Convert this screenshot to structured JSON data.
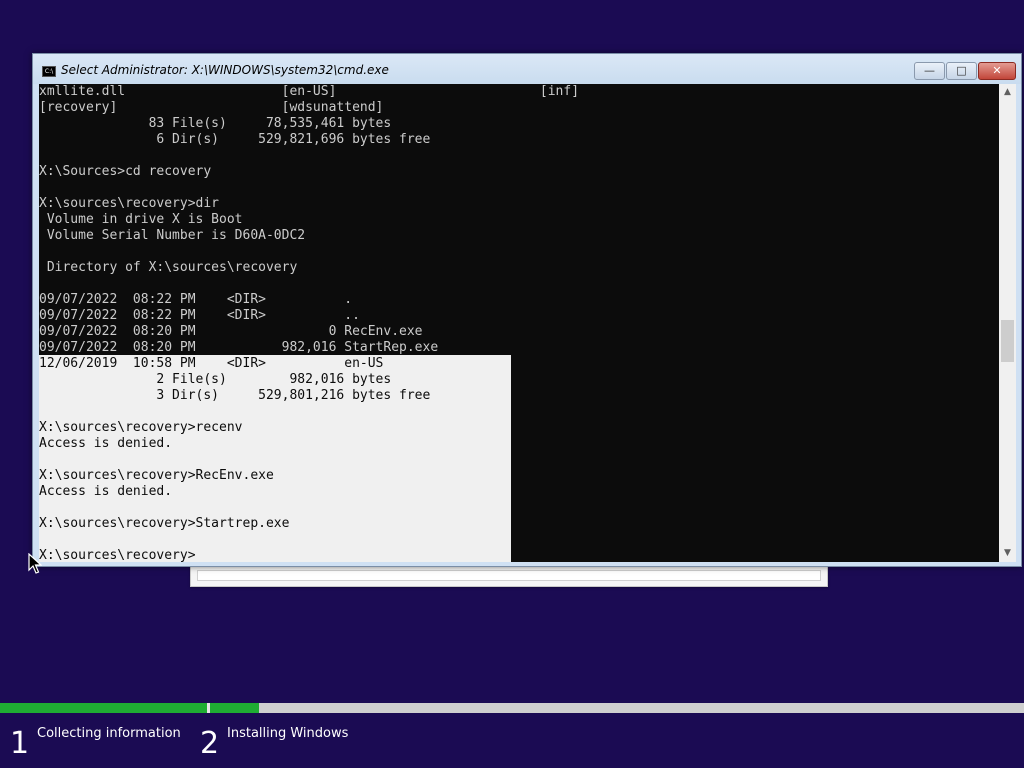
{
  "window": {
    "title": "Select Administrator: X:\\WINDOWS\\system32\\cmd.exe",
    "icon": "cmd-icon",
    "icon_text": "C:\\",
    "minimize_icon": "minimize-icon",
    "maximize_icon": "maximize-icon",
    "close_icon": "close-icon"
  },
  "console": {
    "lines": [
      "xmllite.dll                    [en-US]                          [inf]",
      "[recovery]                     [wdsunattend]",
      "              83 File(s)     78,535,461 bytes",
      "               6 Dir(s)     529,821,696 bytes free",
      "",
      "X:\\Sources>cd recovery",
      "",
      "X:\\sources\\recovery>dir",
      " Volume in drive X is Boot",
      " Volume Serial Number is D60A-0DC2",
      "",
      " Directory of X:\\sources\\recovery",
      "",
      "09/07/2022  08:22 PM    <DIR>          .",
      "09/07/2022  08:22 PM    <DIR>          ..",
      "09/07/2022  08:20 PM                 0 RecEnv.exe",
      "09/07/2022  08:20 PM           982,016 StartRep.exe",
      "12/06/2019  10:58 PM    <DIR>          en-US",
      "               2 File(s)        982,016 bytes",
      "               3 Dir(s)     529,801,216 bytes free",
      "",
      "X:\\sources\\recovery>recenv",
      "Access is denied.",
      "",
      "X:\\sources\\recovery>RecEnv.exe",
      "Access is denied.",
      "",
      "X:\\sources\\recovery>Startrep.exe",
      "",
      "X:\\sources\\recovery>"
    ],
    "selection_start_line": 17,
    "colors": {
      "background": "#0c0c0c",
      "text": "#cccccc",
      "selection": "#f0f0f0"
    }
  },
  "scrollbar": {
    "up_icon": "scroll-up-icon",
    "down_icon": "scroll-down-icon",
    "position": 0.5
  },
  "setup": {
    "steps": [
      {
        "number": "1",
        "label": "Collecting information",
        "progress": 1.0
      },
      {
        "number": "2",
        "label": "Installing Windows",
        "progress": 0.06
      }
    ],
    "colors": {
      "background": "#1b0b53",
      "progress": "#1fad33"
    }
  }
}
